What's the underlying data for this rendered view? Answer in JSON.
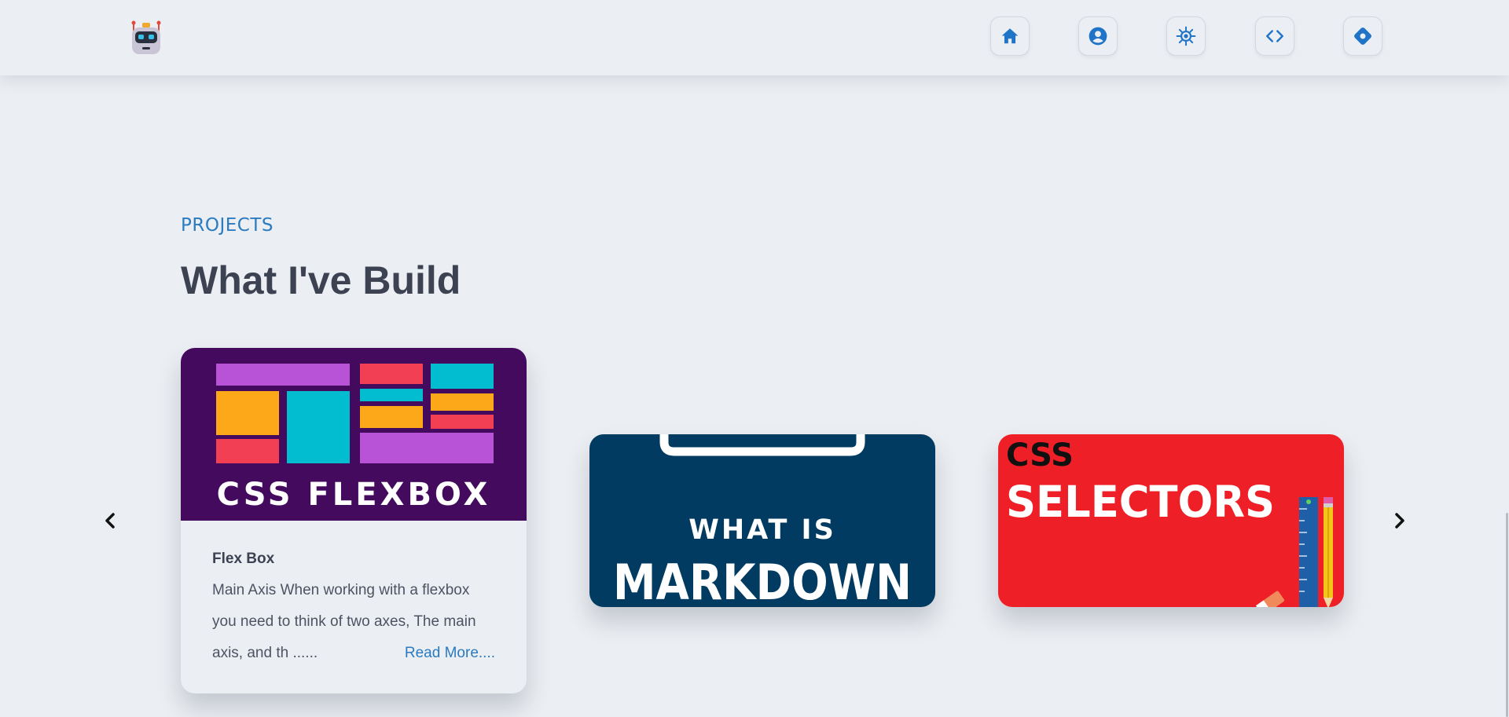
{
  "header": {
    "logo_icon": "robot-logo-icon",
    "nav": [
      {
        "name": "home",
        "icon": "home-icon"
      },
      {
        "name": "about",
        "icon": "user-icon"
      },
      {
        "name": "skills",
        "icon": "gear-icon"
      },
      {
        "name": "projects",
        "icon": "code-icon"
      },
      {
        "name": "contact",
        "icon": "diamond-icon"
      }
    ],
    "accent_color": "#1f74c8"
  },
  "projects": {
    "label": "PROJECTS",
    "title": "What I've Build",
    "cards": [
      {
        "image_text": "CSS FLEXBOX",
        "title": "Flex Box",
        "description": "Main Axis When working with a flexbox you need to think of two axes, The main axis, and th ......",
        "read_more": "Read More...."
      },
      {
        "image_line1": "WHAT IS",
        "image_line2": "MARKDOWN"
      },
      {
        "image_line1": "CSS",
        "image_line2": "SELECTORS"
      }
    ],
    "prev_icon": "chevron-left-icon",
    "next_icon": "chevron-right-icon"
  }
}
